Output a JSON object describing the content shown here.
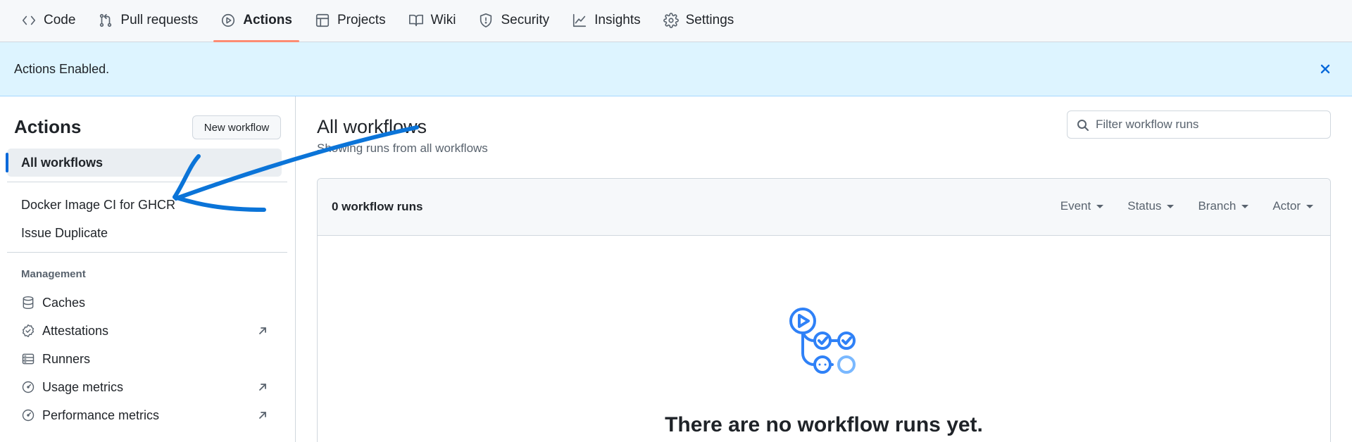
{
  "nav": {
    "tabs": [
      {
        "label": "Code",
        "icon": "code-icon"
      },
      {
        "label": "Pull requests",
        "icon": "git-pull-request-icon"
      },
      {
        "label": "Actions",
        "icon": "play-icon",
        "active": true
      },
      {
        "label": "Projects",
        "icon": "table-icon"
      },
      {
        "label": "Wiki",
        "icon": "book-icon"
      },
      {
        "label": "Security",
        "icon": "shield-icon"
      },
      {
        "label": "Insights",
        "icon": "graph-icon"
      },
      {
        "label": "Settings",
        "icon": "gear-icon"
      }
    ]
  },
  "flash": {
    "message": "Actions Enabled."
  },
  "sidebar": {
    "title": "Actions",
    "new_workflow_label": "New workflow",
    "all_workflows_label": "All workflows",
    "workflows": [
      "Docker Image CI for GHCR",
      "Issue Duplicate"
    ],
    "management_heading": "Management",
    "management": [
      {
        "label": "Caches",
        "icon": "database-icon"
      },
      {
        "label": "Attestations",
        "icon": "verified-icon",
        "external": true
      },
      {
        "label": "Runners",
        "icon": "server-icon"
      },
      {
        "label": "Usage metrics",
        "icon": "meter-icon",
        "external": true
      },
      {
        "label": "Performance metrics",
        "icon": "meter-icon",
        "external": true
      }
    ]
  },
  "main": {
    "title": "All workflows",
    "subtitle": "Showing runs from all workflows",
    "filter_placeholder": "Filter workflow runs",
    "runs_count": "0 workflow runs",
    "filters": [
      "Event",
      "Status",
      "Branch",
      "Actor"
    ],
    "empty_title": "There are no workflow runs yet."
  },
  "colors": {
    "accent": "#0969da",
    "active_tab_underline": "#fd8c73",
    "flash_bg": "#ddf4ff",
    "annotation_stroke": "#0b74d8"
  }
}
